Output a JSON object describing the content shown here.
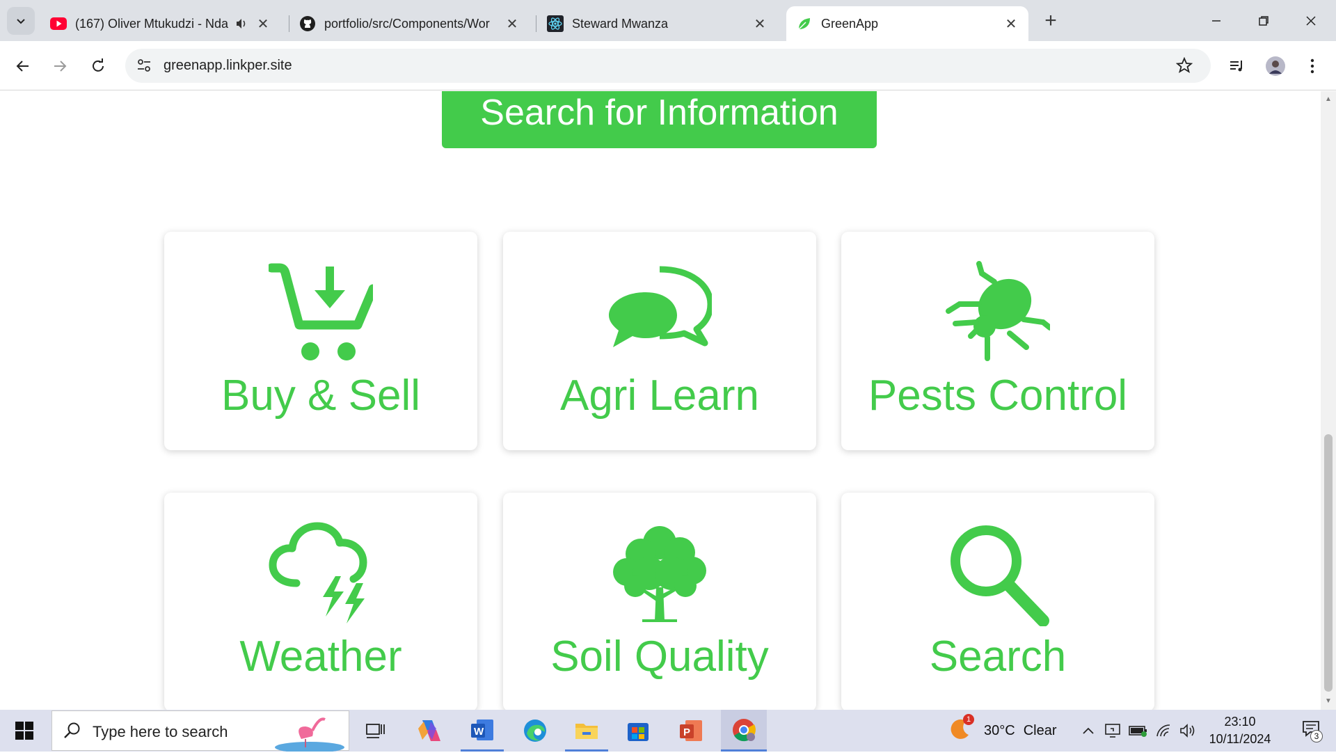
{
  "browser": {
    "tabs": [
      {
        "title": "(167) Oliver Mtukudzi - Nda",
        "favicon": "youtube-icon",
        "audio": true
      },
      {
        "title": "portfolio/src/Components/Wor",
        "favicon": "github-icon"
      },
      {
        "title": "Steward Mwanza",
        "favicon": "react-icon"
      },
      {
        "title": "GreenApp",
        "favicon": "leaf-icon",
        "active": true
      }
    ],
    "url": "greenapp.linkper.site"
  },
  "page": {
    "hero_button": "Search for Information",
    "cards": [
      {
        "label": "Buy & Sell",
        "icon": "cart-download-icon"
      },
      {
        "label": "Agri Learn",
        "icon": "chat-bubbles-icon"
      },
      {
        "label": "Pests Control",
        "icon": "bug-icon"
      },
      {
        "label": "Weather",
        "icon": "storm-cloud-icon"
      },
      {
        "label": "Soil Quality",
        "icon": "tree-icon"
      },
      {
        "label": "Search",
        "icon": "magnifier-icon"
      }
    ],
    "accent_color": "#43cb4b"
  },
  "taskbar": {
    "search_placeholder": "Type here to search",
    "weather": {
      "temp": "30°C",
      "condition": "Clear",
      "badge": "1"
    },
    "clock": {
      "time": "23:10",
      "date": "10/11/2024"
    },
    "notification_count": "3"
  }
}
